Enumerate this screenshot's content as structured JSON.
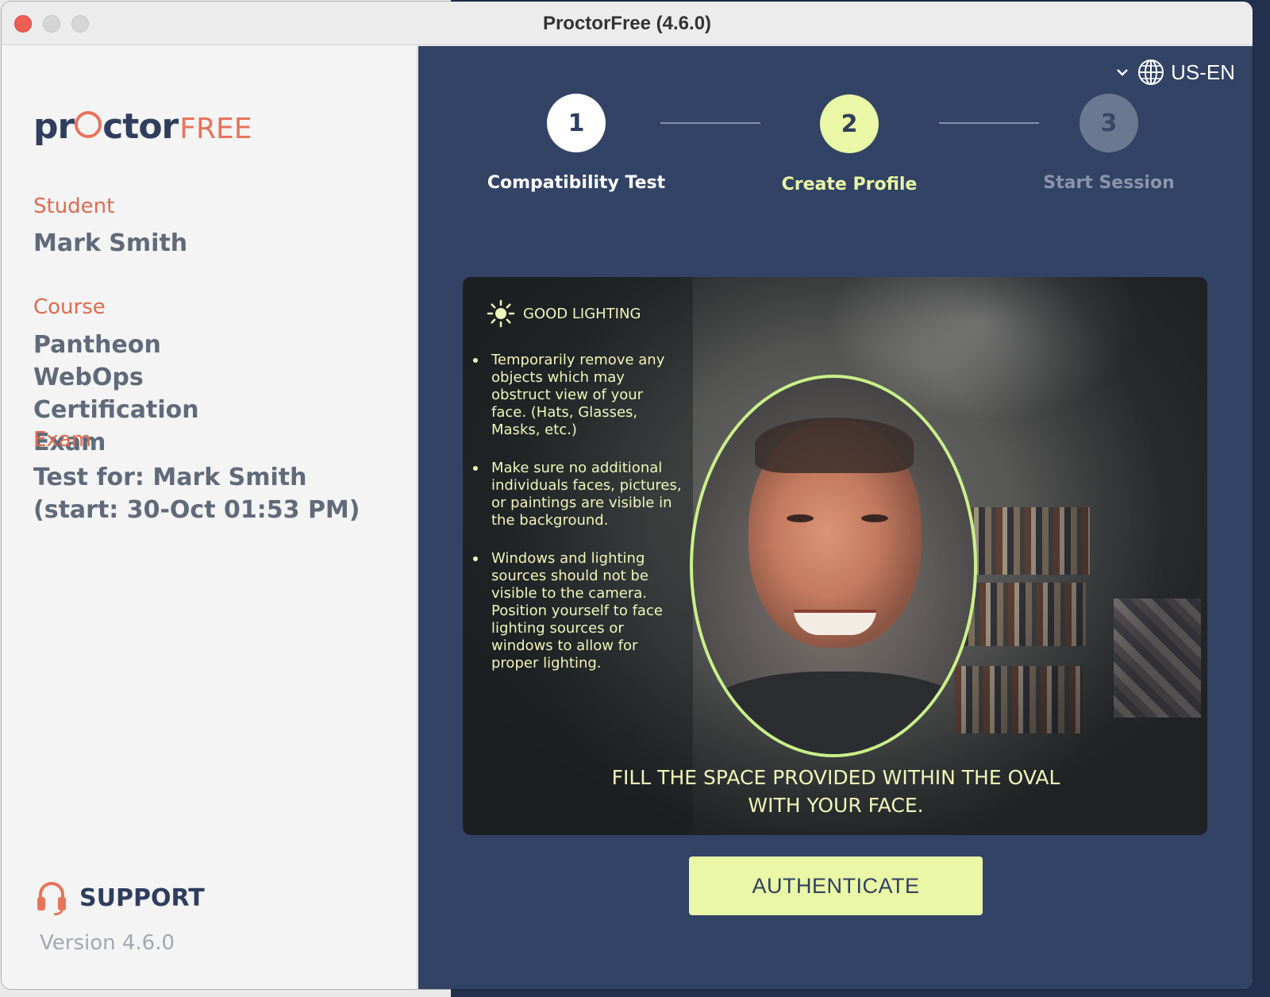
{
  "window": {
    "title": "ProctorFree (4.6.0)"
  },
  "logo": {
    "main_prefix": "pr",
    "main_suffix": "ctor",
    "free": "FREE"
  },
  "sidebar": {
    "student_label": "Student",
    "student_value": "Mark Smith",
    "course_label": "Course",
    "course_value": "Pantheon WebOps Certification Exam",
    "exam_label": "Exam",
    "exam_value": "Test for: Mark Smith (start: 30-Oct 01:53 PM)",
    "support_label": "SUPPORT",
    "version": "Version 4.6.0"
  },
  "language": {
    "selected": "US-EN"
  },
  "steps": [
    {
      "number": "1",
      "label": "Compatibility Test",
      "state": "completed"
    },
    {
      "number": "2",
      "label": "Create Profile",
      "state": "active"
    },
    {
      "number": "3",
      "label": "Start Session",
      "state": "pending"
    }
  ],
  "camera": {
    "lighting_title": "GOOD LIGHTING",
    "tips": [
      "Temporarily remove any objects which may obstruct view of your face. (Hats, Glasses, Masks, etc.)",
      "Make sure no additional individuals faces, pictures, or paintings are visible in the background.",
      "Windows and lighting sources should not be visible to the camera. Position yourself to face lighting sources or windows to allow for proper lighting."
    ],
    "instruction": "FILL THE SPACE PROVIDED WITHIN THE OVAL WITH YOUR FACE."
  },
  "actions": {
    "authenticate_label": "AUTHENTICATE"
  },
  "colors": {
    "accent": "#e9f7a6",
    "brand_orange": "#e8735a",
    "main_bg": "#324366",
    "oval": "#c9f08a"
  },
  "icons": {
    "support": "headset-icon",
    "language": "globe-icon",
    "dropdown": "chevron-down-icon",
    "lighting": "sun-icon"
  }
}
